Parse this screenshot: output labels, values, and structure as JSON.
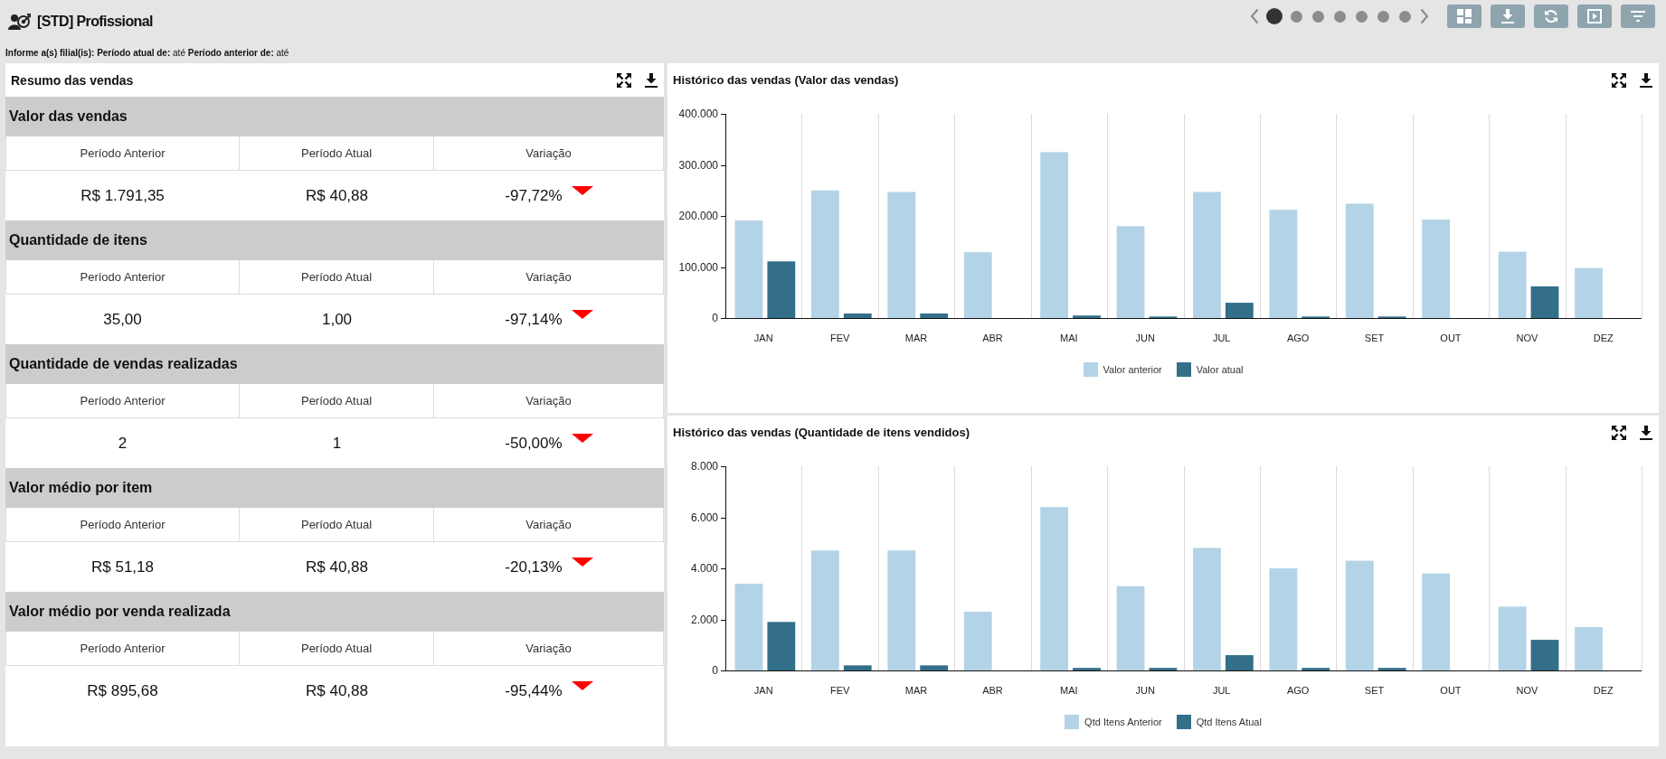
{
  "header": {
    "title": "[STD] Profissional"
  },
  "pager": {
    "pages": [
      {
        "selected": true
      },
      {
        "selected": false
      },
      {
        "selected": false
      },
      {
        "selected": false
      },
      {
        "selected": false
      },
      {
        "selected": false
      },
      {
        "selected": false
      }
    ]
  },
  "filters": {
    "text": "**Informe a(s) filial(is):** **Período atual de:** até **Período anterior de:** até"
  },
  "summary": {
    "title": "Resumo das vendas",
    "sections": [
      {
        "title": "Valor das vendas",
        "columns": [
          "Período Anterior",
          "Período Atual",
          "Variação"
        ],
        "previous": "R$ 1.791,35",
        "current": "R$ 40,88",
        "variation": "-97,72%",
        "declining": true
      },
      {
        "title": "Quantidade de itens",
        "columns": [
          "Período Anterior",
          "Período Atual",
          "Variação"
        ],
        "previous": "35,00",
        "current": "1,00",
        "variation": "-97,14%",
        "declining": true
      },
      {
        "title": "Quantidade de vendas realizadas",
        "columns": [
          "Período Anterior",
          "Período Atual",
          "Variação"
        ],
        "previous": "2",
        "current": "1",
        "variation": "-50,00%",
        "declining": true
      },
      {
        "title": "Valor médio por item",
        "columns": [
          "Período Anterior",
          "Período Atual",
          "Variação"
        ],
        "previous": "R$ 51,18",
        "current": "R$ 40,88",
        "variation": "-20,13%",
        "declining": true
      },
      {
        "title": "Valor médio por venda realizada",
        "columns": [
          "Período Anterior",
          "Período Atual",
          "Variação"
        ],
        "previous": "R$ 895,68",
        "current": "R$ 40,88",
        "variation": "-95,44%",
        "declining": true
      }
    ]
  },
  "charts": [
    {
      "title": "Histórico das vendas (Valor das vendas)",
      "chart_data": {
        "type": "bar",
        "categories": [
          "JAN",
          "FEV",
          "MAR",
          "ABR",
          "MAI",
          "JUN",
          "JUL",
          "AGO",
          "SET",
          "OUT",
          "NOV",
          "DEZ"
        ],
        "series": [
          {
            "name": "Valor anterior",
            "color": "#b3d3e7",
            "values": [
              191000,
              250000,
              247000,
              129000,
              325000,
              180000,
              247000,
              212000,
              224000,
              193000,
              130000,
              98000
            ]
          },
          {
            "name": "Valor atual",
            "color": "#336f89",
            "values": [
              111000,
              9000,
              9000,
              0,
              5000,
              3000,
              30000,
              3000,
              3000,
              0,
              62000,
              0
            ]
          }
        ],
        "ylim": [
          0,
          400000
        ],
        "yticks": [
          {
            "value": 0,
            "label": "0"
          },
          {
            "value": 100000,
            "label": "100.000"
          },
          {
            "value": 200000,
            "label": "200.000"
          },
          {
            "value": 300000,
            "label": "300.000"
          },
          {
            "value": 400000,
            "label": "400.000"
          }
        ]
      }
    },
    {
      "title": "Histórico das vendas (Quantidade de itens vendidos)",
      "chart_data": {
        "type": "bar",
        "categories": [
          "JAN",
          "FEV",
          "MAR",
          "ABR",
          "MAI",
          "JUN",
          "JUL",
          "AGO",
          "SET",
          "OUT",
          "NOV",
          "DEZ"
        ],
        "series": [
          {
            "name": "Qtd Itens Anterior",
            "color": "#b3d3e7",
            "values": [
              3400,
              4700,
              4700,
              2300,
              6400,
              3300,
              4800,
              4000,
              4300,
              3800,
              2500,
              1700
            ]
          },
          {
            "name": "Qtd Itens Atual",
            "color": "#336f89",
            "values": [
              1900,
              200,
              200,
              0,
              100,
              100,
              600,
              100,
              100,
              0,
              1200,
              0
            ]
          }
        ],
        "ylim": [
          0,
          8000
        ],
        "yticks": [
          {
            "value": 0,
            "label": "0"
          },
          {
            "value": 2000,
            "label": "2.000"
          },
          {
            "value": 4000,
            "label": "4.000"
          },
          {
            "value": 6000,
            "label": "6.000"
          },
          {
            "value": 8000,
            "label": "8.000"
          }
        ]
      }
    }
  ]
}
